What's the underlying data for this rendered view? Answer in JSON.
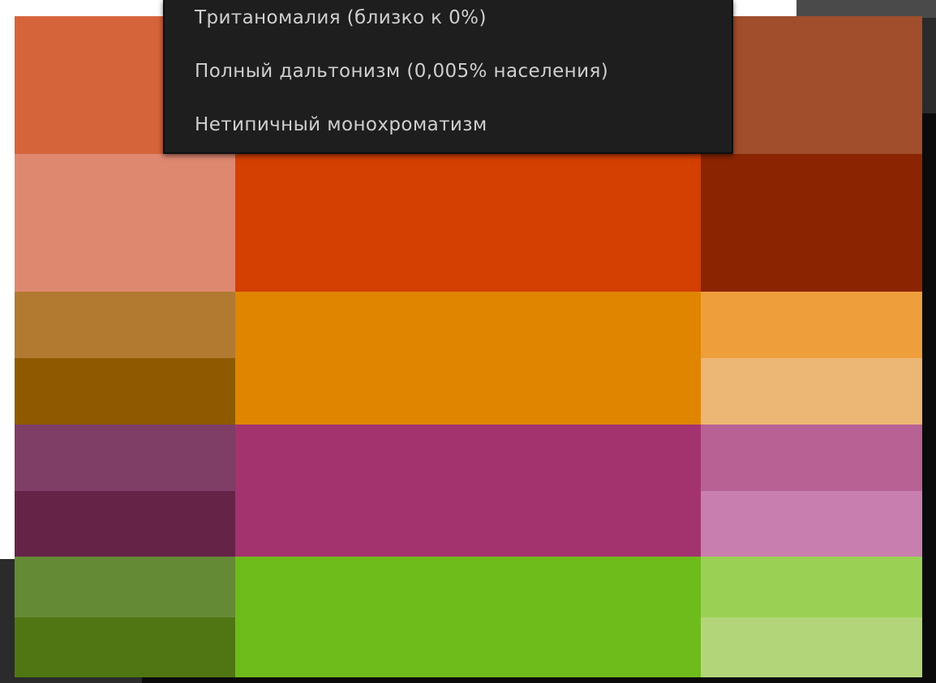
{
  "menu": {
    "items": [
      {
        "label": "Тританомалия (близко к 0%)"
      },
      {
        "label": "Полный дальтонизм (0,005% населения)"
      },
      {
        "label": "Нетипичный монохроматизм"
      }
    ]
  },
  "palette": {
    "swatches": [
      {
        "name": "swatch-orange-left",
        "color": "#d6643a"
      },
      {
        "name": "swatch-brown-right",
        "color": "#a14e2c"
      },
      {
        "name": "swatch-salmon",
        "color": "#df8870"
      },
      {
        "name": "swatch-red-orange",
        "color": "#d43f02"
      },
      {
        "name": "swatch-maroon",
        "color": "#8b2501"
      },
      {
        "name": "swatch-ochre",
        "color": "#b27931"
      },
      {
        "name": "swatch-dark-ochre",
        "color": "#8f5900"
      },
      {
        "name": "swatch-orange",
        "color": "#df8500"
      },
      {
        "name": "swatch-light-orange",
        "color": "#ee9f3b"
      },
      {
        "name": "swatch-peach",
        "color": "#ecb674"
      },
      {
        "name": "swatch-plum",
        "color": "#7f3e65"
      },
      {
        "name": "swatch-dark-plum",
        "color": "#662348"
      },
      {
        "name": "swatch-magenta",
        "color": "#a3336e"
      },
      {
        "name": "swatch-pink",
        "color": "#b76194"
      },
      {
        "name": "swatch-light-pink",
        "color": "#c87fb0"
      },
      {
        "name": "swatch-olive-green",
        "color": "#648a35"
      },
      {
        "name": "swatch-dark-green",
        "color": "#4f7613"
      },
      {
        "name": "swatch-green",
        "color": "#6ebb1c"
      },
      {
        "name": "swatch-light-green",
        "color": "#9ad155"
      },
      {
        "name": "swatch-pale-green",
        "color": "#b2d579"
      }
    ]
  }
}
